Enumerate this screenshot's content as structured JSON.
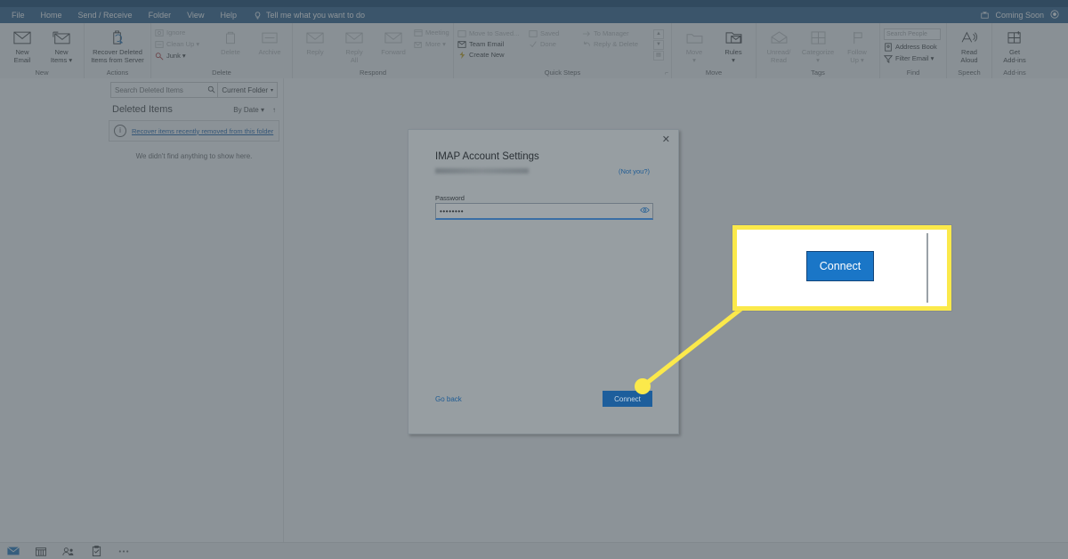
{
  "app": {
    "title_bar": {
      "coming_soon": "Coming Soon"
    },
    "tabs": [
      {
        "label": "File",
        "active": false
      },
      {
        "label": "Home",
        "active": true
      },
      {
        "label": "Send / Receive",
        "active": false
      },
      {
        "label": "Folder",
        "active": false
      },
      {
        "label": "View",
        "active": false
      },
      {
        "label": "Help",
        "active": false
      }
    ],
    "tell_me": "Tell me what you want to do",
    "ribbon_groups": [
      {
        "label": "New",
        "buttons": [
          {
            "label": "New\nEmail",
            "icon": "envelope-icon",
            "enabled": true
          },
          {
            "label": "New\nItems ▾",
            "icon": "new-items-icon",
            "enabled": true
          }
        ]
      },
      {
        "label": "Actions",
        "buttons": [
          {
            "label": "Recover Deleted\nItems from Server",
            "icon": "recover-deleted-icon",
            "enabled": true
          }
        ]
      },
      {
        "label": "Delete",
        "small": [
          {
            "label": "Ignore",
            "icon": "ignore-icon",
            "enabled": false
          },
          {
            "label": "Clean Up ▾",
            "icon": "clean-up-icon",
            "enabled": false
          },
          {
            "label": "Junk ▾",
            "icon": "junk-icon",
            "enabled": true
          }
        ],
        "buttons": [
          {
            "label": "Delete",
            "icon": "trash-icon",
            "enabled": false
          },
          {
            "label": "Archive",
            "icon": "archive-icon",
            "enabled": false
          }
        ]
      },
      {
        "label": "Respond",
        "buttons": [
          {
            "label": "Reply",
            "icon": "reply-icon",
            "enabled": false
          },
          {
            "label": "Reply\nAll",
            "icon": "reply-all-icon",
            "enabled": false
          },
          {
            "label": "Forward",
            "icon": "forward-icon",
            "enabled": false
          }
        ],
        "small": [
          {
            "label": "Meeting",
            "icon": "meeting-icon",
            "enabled": false
          },
          {
            "label": "More ▾",
            "icon": "more-icon",
            "enabled": false
          }
        ]
      },
      {
        "label": "Quick Steps",
        "col1": [
          {
            "label": "Move to Saved...",
            "icon": "move-to-icon",
            "enabled": false
          },
          {
            "label": "Team Email",
            "icon": "team-email-icon",
            "enabled": true
          },
          {
            "label": "Create New",
            "icon": "create-new-icon",
            "enabled": true
          }
        ],
        "col2": [
          {
            "label": "Saved",
            "icon": "saved-icon",
            "enabled": false
          },
          {
            "label": "Done",
            "icon": "done-icon",
            "enabled": false
          }
        ],
        "col3": [
          {
            "label": "To Manager",
            "icon": "to-manager-icon",
            "enabled": false
          },
          {
            "label": "Reply & Delete",
            "icon": "reply-delete-icon",
            "enabled": false
          }
        ]
      },
      {
        "label": "Move",
        "buttons": [
          {
            "label": "Move\n▾",
            "icon": "move-icon",
            "enabled": false
          },
          {
            "label": "Rules\n▾",
            "icon": "rules-icon",
            "enabled": true
          }
        ]
      },
      {
        "label": "Tags",
        "buttons": [
          {
            "label": "Unread/\nRead",
            "icon": "unread-read-icon",
            "enabled": false
          },
          {
            "label": "Categorize\n▾",
            "icon": "categorize-icon",
            "enabled": false
          },
          {
            "label": "Follow\nUp ▾",
            "icon": "follow-up-icon",
            "enabled": false
          }
        ]
      },
      {
        "label": "Find",
        "search_people_placeholder": "Search People",
        "small": [
          {
            "label": "Address Book",
            "icon": "address-book-icon",
            "enabled": true
          },
          {
            "label": "Filter Email ▾",
            "icon": "filter-email-icon",
            "enabled": true
          }
        ]
      },
      {
        "label": "Speech",
        "buttons": [
          {
            "label": "Read\nAloud",
            "icon": "read-aloud-icon",
            "enabled": true
          }
        ]
      },
      {
        "label": "Add-ins",
        "buttons": [
          {
            "label": "Get\nAdd-ins",
            "icon": "get-add-ins-icon",
            "enabled": true
          }
        ]
      }
    ]
  },
  "list_pane": {
    "search_placeholder": "Search Deleted Items",
    "scope": "Current Folder",
    "folder_title": "Deleted Items",
    "sort_by": "By Date ▾",
    "recover_link": "Recover items recently removed from this folder",
    "empty_message": "We didn't find anything to show here."
  },
  "bottom_bar": {
    "items": [
      {
        "name": "mail-icon"
      },
      {
        "name": "calendar-icon"
      },
      {
        "name": "people-icon"
      },
      {
        "name": "tasks-icon"
      },
      {
        "name": "more-options-icon"
      }
    ]
  },
  "dialog": {
    "title": "IMAP Account Settings",
    "email_redacted": "",
    "not_you_link": "(Not you?)",
    "password_label": "Password",
    "password_value": "••••••••",
    "go_back_label": "Go back",
    "connect_label": "Connect",
    "close_label": "✕",
    "show_password_icon": "eye-icon"
  },
  "callout": {
    "zoomed_button_label": "Connect",
    "border_color": "#fbe94b",
    "button_color": "#1a76c7",
    "highlight_dot_color": "#fbe94b"
  }
}
